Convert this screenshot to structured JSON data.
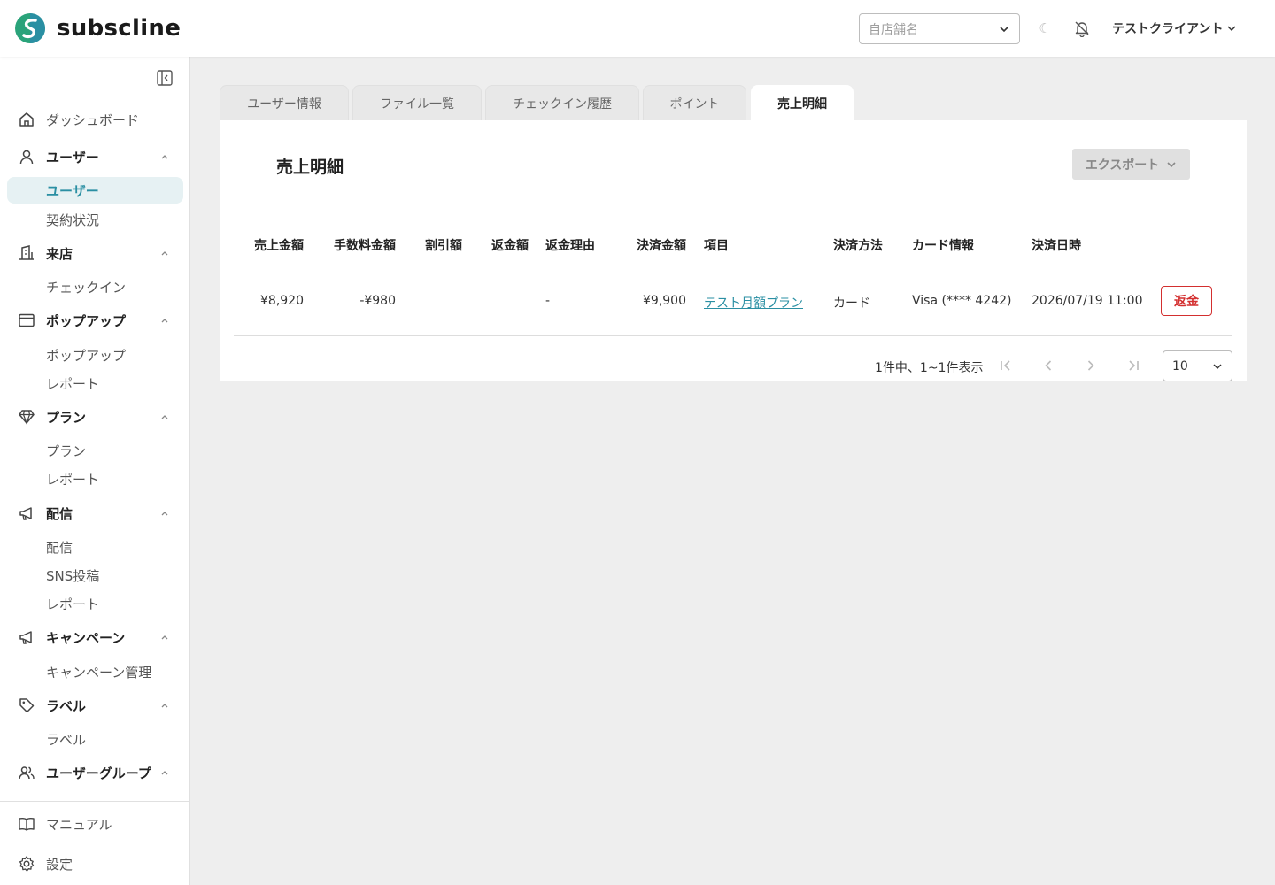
{
  "app": {
    "name": "subscline"
  },
  "header": {
    "store_placeholder": "自店舗名",
    "user_name": "テストクライアント"
  },
  "sidebar": {
    "sections": [
      {
        "label": "ダッシュボード"
      },
      {
        "label": "ユーザー",
        "items": [
          "ユーザー",
          "契約状況"
        ]
      },
      {
        "label": "来店",
        "items": [
          "チェックイン"
        ]
      },
      {
        "label": "ポップアップ",
        "items": [
          "ポップアップ",
          "レポート"
        ]
      },
      {
        "label": "プラン",
        "items": [
          "プラン",
          "レポート"
        ]
      },
      {
        "label": "配信",
        "items": [
          "配信",
          "SNS投稿",
          "レポート"
        ]
      },
      {
        "label": "キャンペーン",
        "items": [
          "キャンペーン管理"
        ]
      },
      {
        "label": "ラベル",
        "items": [
          "ラベル"
        ]
      },
      {
        "label": "ユーザーグループ"
      }
    ],
    "footer": [
      {
        "label": "マニュアル"
      },
      {
        "label": "設定"
      }
    ]
  },
  "tabs": [
    "ユーザー情報",
    "ファイル一覧",
    "チェックイン履歴",
    "ポイント",
    "売上明細"
  ],
  "card": {
    "title": "売上明細",
    "export_label": "エクスポート",
    "columns": [
      "売上金額",
      "手数料金額",
      "割引額",
      "返金額",
      "返金理由",
      "決済金額",
      "項目",
      "決済方法",
      "カード情報",
      "決済日時"
    ],
    "rows": [
      [
        "¥8,920",
        "-¥980",
        "",
        "",
        "-",
        "¥9,900",
        "テスト月額プラン",
        "カード",
        "Visa (**** 4242)",
        "2026/07/19 11:00"
      ]
    ],
    "refund_label": "返金",
    "pagination_text": "1件中、1~1件表示",
    "per_page": "10"
  },
  "colors": {
    "accent": "#2a8fa3",
    "danger": "#d32f2f",
    "active_bg": "#e6f1f3"
  }
}
